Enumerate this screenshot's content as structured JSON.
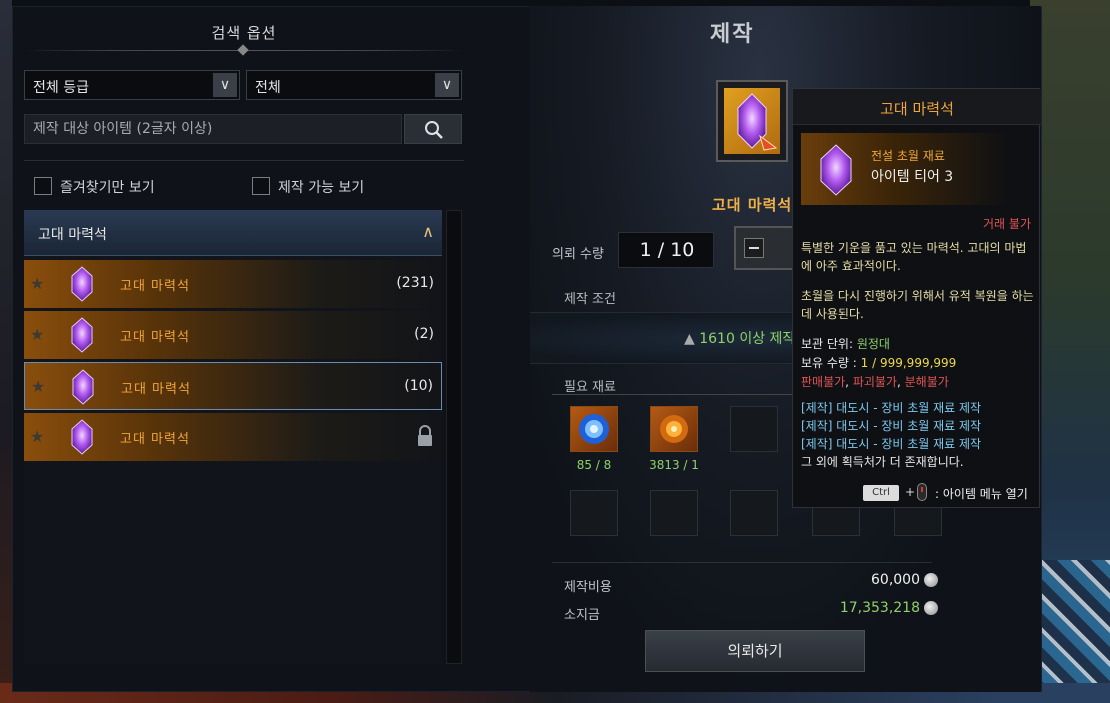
{
  "left_panel": {
    "title": "검색 옵션",
    "grade_select": "전체 등급",
    "type_select": "전체",
    "search_placeholder": "제작 대상 아이템 (2글자 이상)",
    "favorites_label": "즐겨찾기만 보기",
    "craftable_label": "제작 가능 보기",
    "category": "고대 마력석",
    "items": [
      {
        "name": "고대 마력석",
        "count": "(231)",
        "locked": false,
        "selected": false
      },
      {
        "name": "고대 마력석",
        "count": "(2)",
        "locked": false,
        "selected": false
      },
      {
        "name": "고대 마력석",
        "count": "(10)",
        "locked": false,
        "selected": true
      },
      {
        "name": "고대 마력석",
        "count": "",
        "locked": true,
        "selected": false
      }
    ]
  },
  "craft": {
    "title": "제작",
    "item_name": "고대 마력석",
    "qty_label": "의뢰 수량",
    "qty_value": "1 / 10",
    "condition_label": "제작 조건",
    "condition_text": "1610 이상 제작",
    "materials_label": "필요 재료",
    "materials": [
      {
        "icon": "blue-crystal-icon",
        "count": "85 / 8"
      },
      {
        "icon": "orange-orb-icon",
        "count": "3813 / 1"
      }
    ],
    "cost_label": "제작비용",
    "cost_value": "60,000",
    "owned_label": "소지금",
    "owned_value": "17,353,218",
    "commission_button": "의뢰하기"
  },
  "tooltip": {
    "title": "고대 마력석",
    "grade": "전설 초월 재료",
    "tier": "아이템 티어 3",
    "trade": "거래 불가",
    "desc1": "특별한 기운을 품고 있는 마력석. 고대의 마법에 아주 효과적이다.",
    "desc2": "초월을 다시 진행하기 위해서 유적 복원을 하는 데 사용된다.",
    "storage_label": "보관 단위: ",
    "storage_value": "원정대",
    "owned_label": "보유 수량 : ",
    "owned_value": "1 / 999,999,999",
    "restrict1": "판매불가",
    "restrict2": "파괴불가",
    "restrict3": "분해불가",
    "sources": [
      "[제작] 대도시 - 장비 초월 재료 제작",
      "[제작] 대도시 - 장비 초월 재료 제작",
      "[제작] 대도시 - 장비 초월 재료 제작"
    ],
    "more_sources": "그 외에 획득처가 더 존재합니다.",
    "ctrl_key": "Ctrl",
    "plus": "+",
    "menu_hint": ": 아이템 메뉴 열기"
  }
}
